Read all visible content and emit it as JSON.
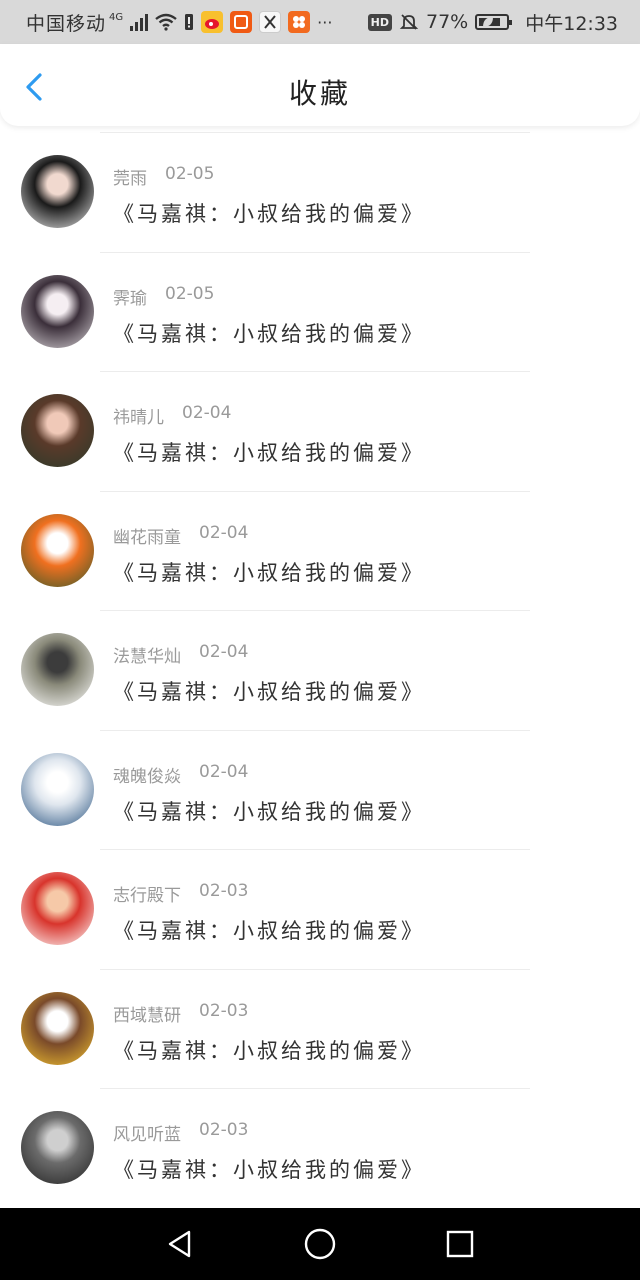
{
  "status_bar": {
    "carrier": "中国移动",
    "network": "4G",
    "battery": "77%",
    "time": "中午12:33",
    "hd": "HD",
    "more": "···",
    "icons": [
      "signal-icon",
      "wifi-icon",
      "sim-alert-icon",
      "weibo-icon",
      "taobao-icon",
      "app-icon",
      "app-icon",
      "hd-icon",
      "mute-icon",
      "leaf-icon",
      "battery-icon"
    ]
  },
  "header": {
    "title": "收藏",
    "back_icon": "chevron-left-icon",
    "accent": "#2e9bf0"
  },
  "favorites": [
    {
      "name": "莞雨",
      "date": "02-05",
      "title": "《马嘉祺：小叔给我的偏爱》",
      "avatar_colors": [
        "#e8e8e8",
        "#1a1a1a",
        "#f1d9cf"
      ]
    },
    {
      "name": "霁瑜",
      "date": "02-05",
      "title": "《马嘉祺：小叔给我的偏爱》",
      "avatar_colors": [
        "#d9d4d8",
        "#3b2f3a",
        "#f5eef2"
      ]
    },
    {
      "name": "祎晴儿",
      "date": "02-04",
      "title": "《马嘉祺：小叔给我的偏爱》",
      "avatar_colors": [
        "#2b3b2a",
        "#5a3a2a",
        "#f0c9b8"
      ]
    },
    {
      "name": "幽花雨童",
      "date": "02-04",
      "title": "《马嘉祺：小叔给我的偏爱》",
      "avatar_colors": [
        "#3a5a2a",
        "#f07020",
        "#ffffff"
      ]
    },
    {
      "name": "法慧华灿",
      "date": "02-04",
      "title": "《马嘉祺：小叔给我的偏爱》",
      "avatar_colors": [
        "#ffffff",
        "#8a8a7a",
        "#3c3c3c"
      ]
    },
    {
      "name": "魂魄俊焱",
      "date": "02-04",
      "title": "《马嘉祺：小叔给我的偏爱》",
      "avatar_colors": [
        "#27527f",
        "#dfe6ee",
        "#ffffff"
      ]
    },
    {
      "name": "志行殿下",
      "date": "02-03",
      "title": "《马嘉祺：小叔给我的偏爱》",
      "avatar_colors": [
        "#ffffff",
        "#d8342c",
        "#f6c9a8"
      ]
    },
    {
      "name": "西域慧研",
      "date": "02-03",
      "title": "《马嘉祺：小叔给我的偏爱》",
      "avatar_colors": [
        "#f2c230",
        "#7a4a2a",
        "#ffffff"
      ]
    },
    {
      "name": "风见听蓝",
      "date": "02-03",
      "title": "《马嘉祺：小叔给我的偏爱》",
      "avatar_colors": [
        "#222222",
        "#6b6b6b",
        "#cfcfcf"
      ]
    }
  ],
  "nav_bar": {
    "back_icon": "triangle-back-icon",
    "home_icon": "circle-home-icon",
    "recents_icon": "square-recents-icon"
  }
}
